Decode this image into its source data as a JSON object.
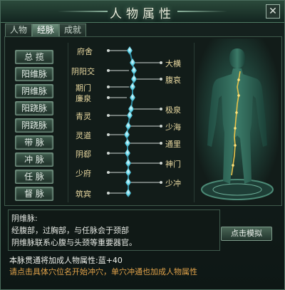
{
  "window": {
    "title": "人物属性",
    "close": "✕"
  },
  "tabs": [
    {
      "label": "人物",
      "active": false
    },
    {
      "label": "经脉",
      "active": true
    },
    {
      "label": "成就",
      "active": false
    }
  ],
  "meridians": [
    "总  揽",
    "阳维脉",
    "阴维脉",
    "阳跷脉",
    "阴跷脉",
    "带  脉",
    "冲  脉",
    "任  脉",
    "督  脉"
  ],
  "points_left": [
    "府舍",
    "阴阳交",
    "期门",
    "廉泉",
    "青灵",
    "灵道",
    "阴郄",
    "少府",
    "筑宾"
  ],
  "points_right": [
    "大横",
    "腹哀",
    "极泉",
    "少海",
    "通里",
    "神门",
    "少冲"
  ],
  "description": {
    "title": "阴维脉:",
    "line1": "经腹部，过胸部，与任脉会于颈部",
    "line2": "阴维脉联系心腹与头颈等重要器官。"
  },
  "simulate_button": "点击模拟",
  "bonus_text": "本脉贯通将加成人物属性:蓝+40",
  "hint_text": "请点击具体穴位名开始冲穴，单穴冲通也加成人物属性",
  "colors": {
    "point_glow": "#5fd4e8",
    "label": "#e8d8a0",
    "hint": "#e0a24a"
  }
}
